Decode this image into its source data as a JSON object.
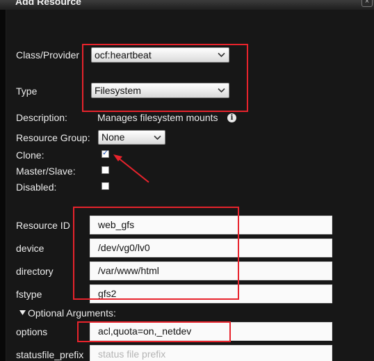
{
  "dialog": {
    "title": "Add Resource",
    "close_label": "×"
  },
  "form": {
    "class_provider": {
      "label": "Class/Provider",
      "value": "ocf:heartbeat"
    },
    "type": {
      "label": "Type",
      "value": "Filesystem"
    },
    "description": {
      "label": "Description:",
      "value": "Manages filesystem mounts"
    },
    "resource_group": {
      "label": "Resource Group:",
      "value": "None"
    },
    "clone": {
      "label": "Clone:",
      "checked": true
    },
    "master_slave": {
      "label": "Master/Slave:",
      "checked": false
    },
    "disabled": {
      "label": "Disabled:",
      "checked": false
    },
    "resource_id": {
      "label": "Resource ID",
      "value": "web_gfs"
    },
    "device": {
      "label": "device",
      "value": "/dev/vg0/lv0"
    },
    "directory": {
      "label": "directory",
      "value": "/var/www/html"
    },
    "fstype": {
      "label": "fstype",
      "value": "gfs2"
    },
    "optional_header": "Optional Arguments:",
    "options": {
      "label": "options",
      "value": "acl,quota=on,_netdev"
    },
    "statusfile_prefix": {
      "label": "statusfile_prefix",
      "placeholder": "status file prefix"
    }
  },
  "annotation_color": "#e8232c"
}
